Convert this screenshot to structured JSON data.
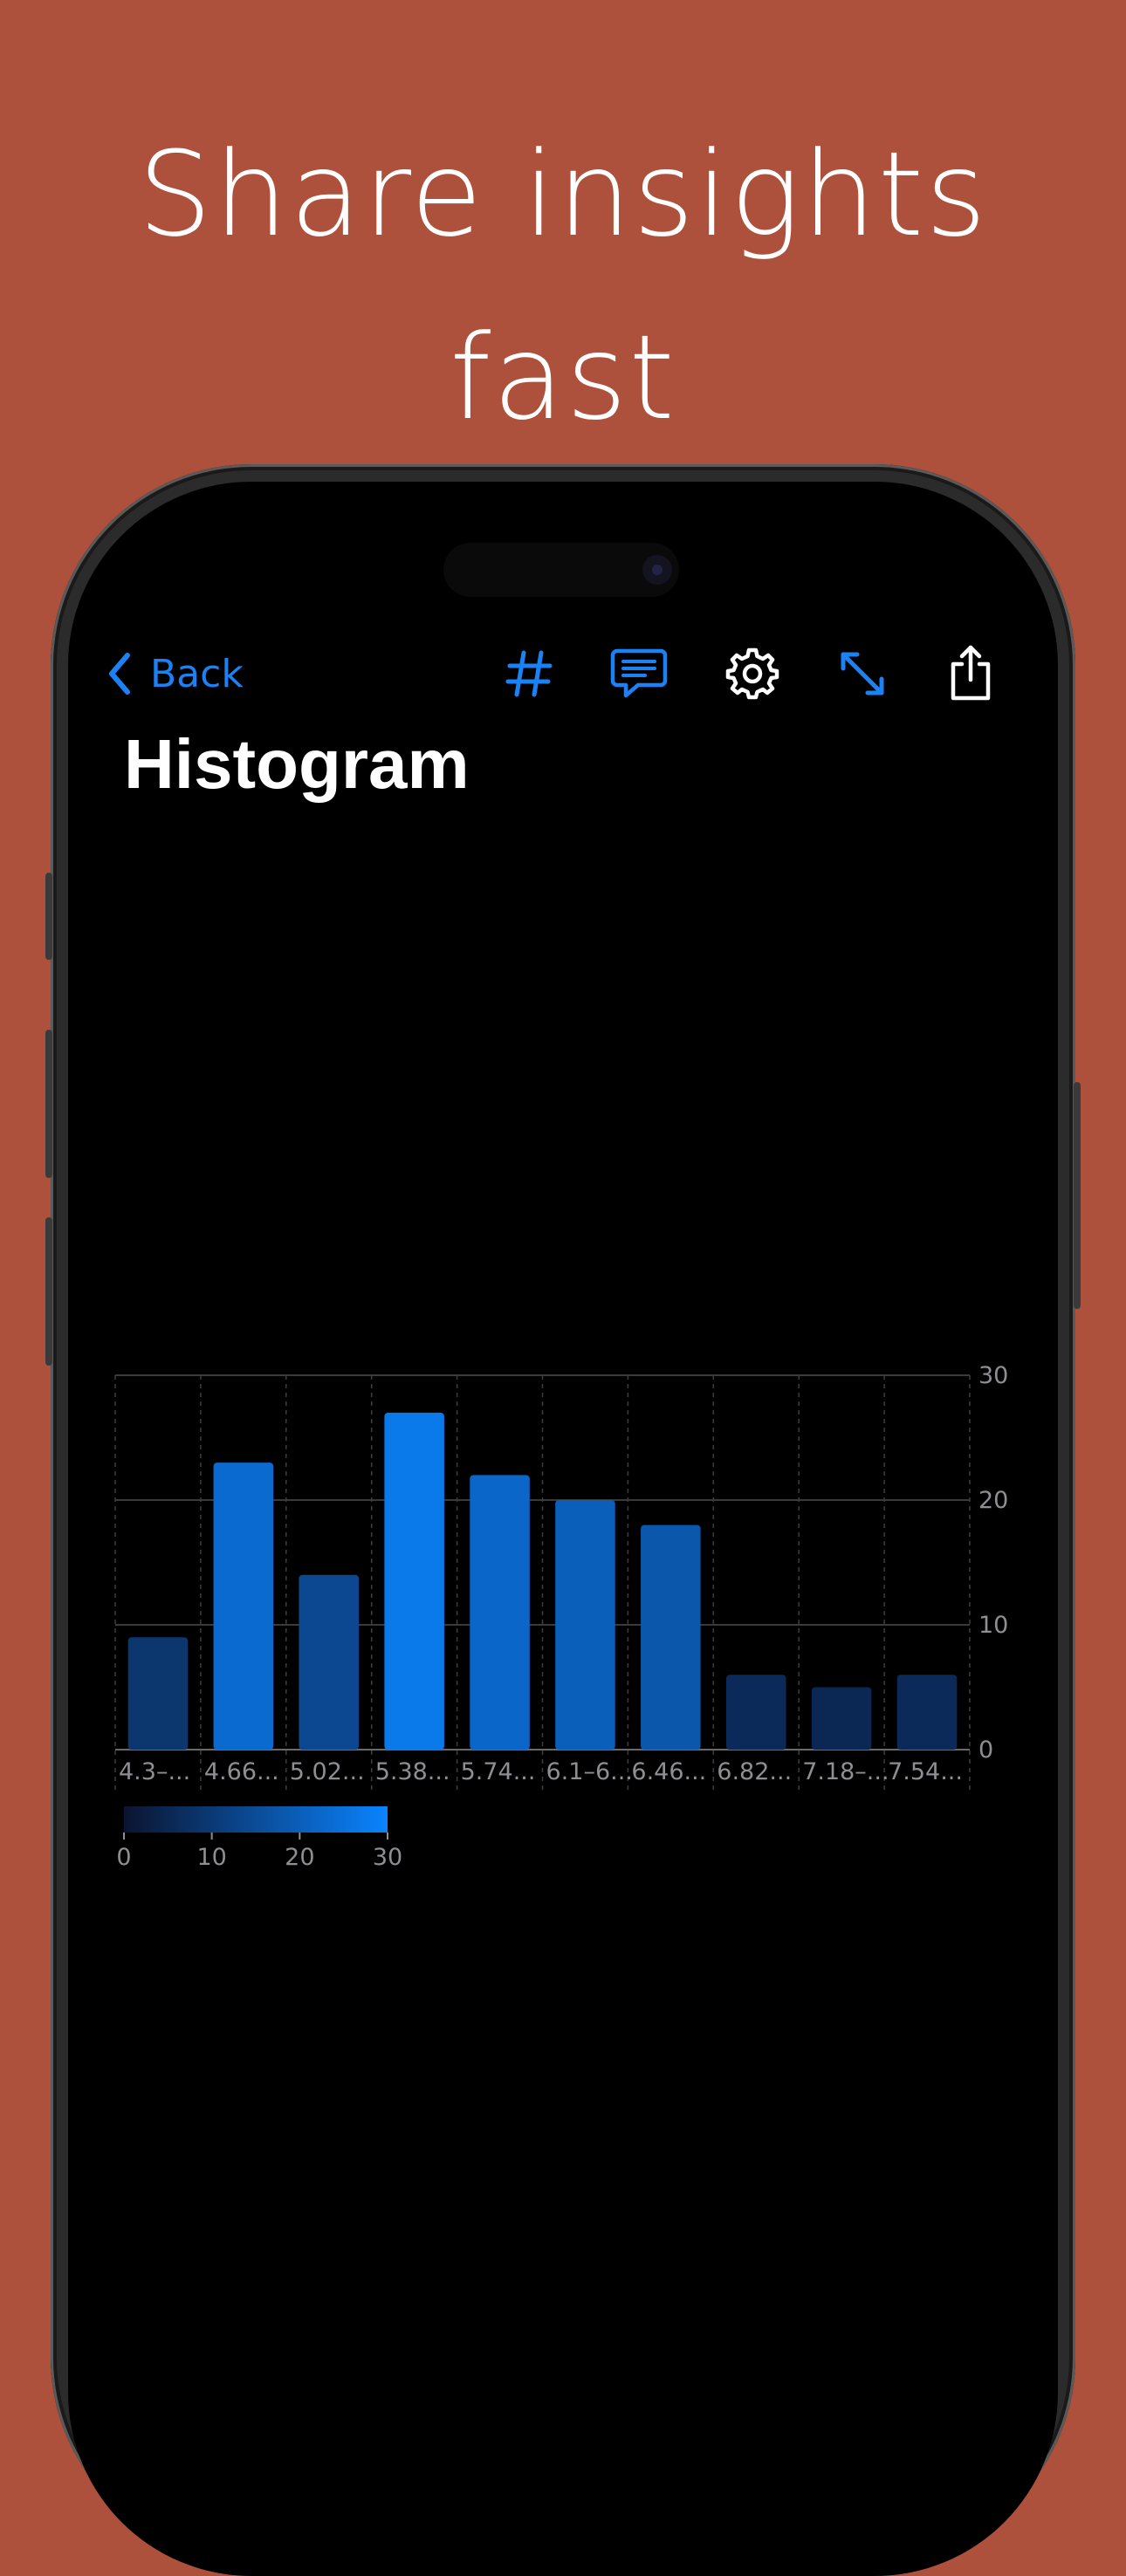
{
  "marketing": {
    "headline_line1": "Share insights",
    "headline_line2": "fast"
  },
  "nav": {
    "back_label": "Back",
    "icons": [
      "hashtag-icon",
      "comment-icon",
      "gear-icon",
      "expand-icon",
      "share-icon"
    ]
  },
  "page": {
    "title": "Histogram"
  },
  "colors": {
    "accent": "#1A82F5",
    "background": "#AD503C",
    "bar_max": "#0A84FF",
    "bar_min": "#0B1430"
  },
  "chart_data": {
    "type": "bar",
    "categories": [
      "4.3–...",
      "4.66...",
      "5.02...",
      "5.38...",
      "5.74...",
      "6.1–6...",
      "6.46...",
      "6.82...",
      "7.18–...",
      "7.54..."
    ],
    "values": [
      9,
      23,
      14,
      27,
      22,
      20,
      18,
      6,
      5,
      6
    ],
    "ylim": [
      0,
      30
    ],
    "y_ticks": [
      "0",
      "10",
      "20",
      "30"
    ],
    "y_axis_side": "right",
    "grid": true,
    "legend": {
      "type": "color-scale",
      "ticks": [
        "0",
        "10",
        "20",
        "30"
      ],
      "range": [
        0,
        30
      ],
      "placement": "bottom-left"
    }
  }
}
